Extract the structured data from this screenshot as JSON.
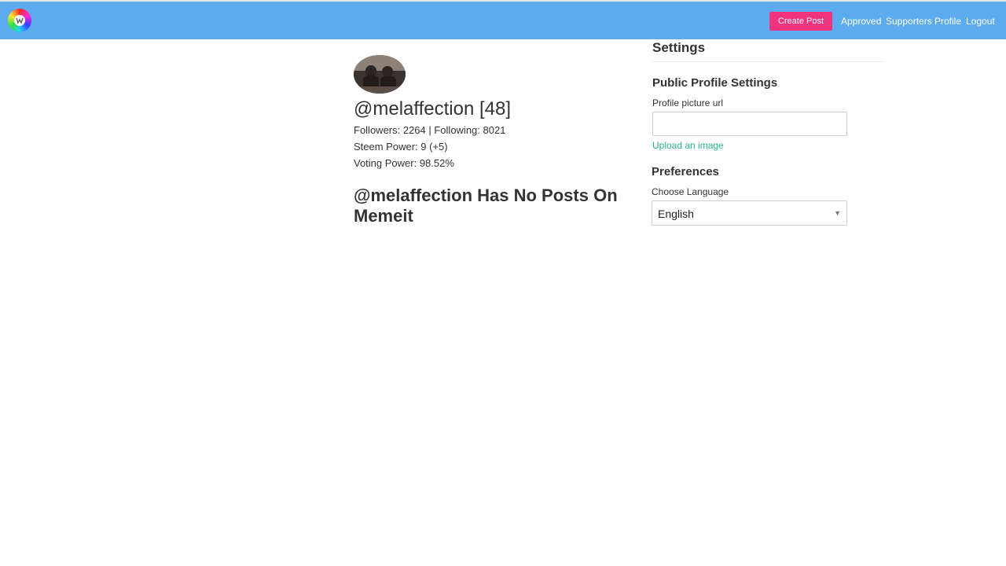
{
  "navbar": {
    "logo_icon": "memeit-logo-icon",
    "create_post_label": "Create Post",
    "links": [
      "Approved",
      "Supporters",
      "Profile",
      "Logout"
    ],
    "colors": {
      "bar": "#5dabef",
      "create_button": "#f0337d"
    }
  },
  "profile": {
    "avatar_icon": "user-avatar-photo",
    "handle": "@melaffection [48]",
    "followers_line": "Followers: 2264 | Following: 8021",
    "steem_power_line": "Steem Power: 9 (+5)",
    "voting_power_line": "Voting Power: 98.52%",
    "no_posts_message": "@melaffection Has No Posts On Memeit"
  },
  "settings": {
    "title": "Settings",
    "public_profile": {
      "heading": "Public Profile Settings",
      "picture_url_label": "Profile picture url",
      "picture_url_value": "",
      "upload_link": "Upload an image"
    },
    "preferences": {
      "heading": "Preferences",
      "language_label": "Choose Language",
      "language_selected": "English",
      "dropdown_icon": "caret-down-icon"
    },
    "colors": {
      "link": "#27b38f"
    }
  }
}
